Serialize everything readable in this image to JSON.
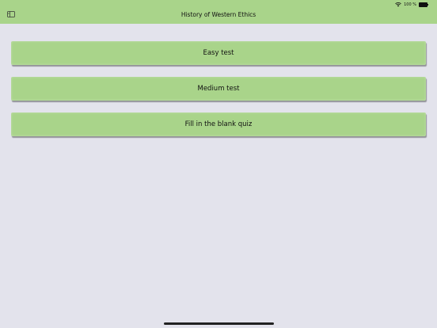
{
  "status_bar": {
    "battery_text": "100 %",
    "battery_level": 1.0,
    "wifi_icon": "wifi-icon",
    "battery_icon": "battery-icon"
  },
  "header": {
    "title": "History of Western Ethics",
    "sidebar_icon": "sidebar-toggle-icon"
  },
  "menu": {
    "easy_label": "Easy test",
    "medium_label": "Medium test",
    "fill_label": "Fill in the blank quiz"
  },
  "colors": {
    "accent": "#a9d48a",
    "background": "#e3e3ec"
  }
}
